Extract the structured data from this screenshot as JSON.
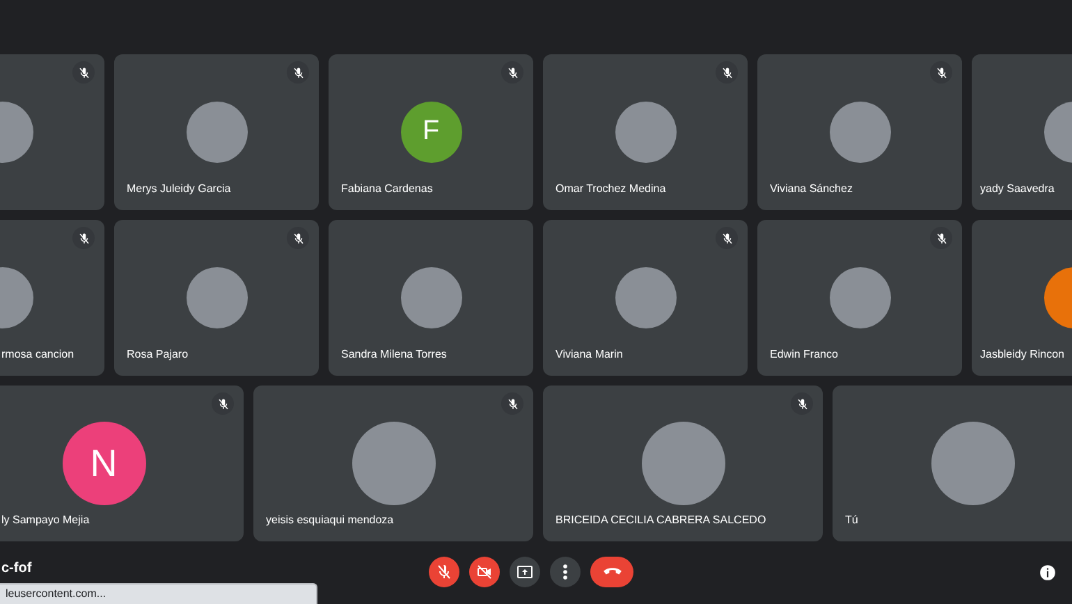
{
  "rows": [
    {
      "tiles": [
        {
          "avatar": {
            "kind": "photo"
          },
          "muted": true
        },
        {
          "name": "Merys Juleidy Garcia",
          "avatar": {
            "kind": "photo"
          },
          "muted": true
        },
        {
          "name": "Fabiana Cardenas",
          "avatar": {
            "kind": "letter",
            "letter": "F",
            "color": "#5e9e2e"
          },
          "muted": true
        },
        {
          "name": "Omar Trochez Medina",
          "avatar": {
            "kind": "photo"
          },
          "muted": true
        },
        {
          "name": "Viviana Sánchez",
          "avatar": {
            "kind": "photo"
          },
          "muted": true
        },
        {
          "name": "yady Saavedra",
          "avatar": {
            "kind": "photo"
          },
          "muted": false
        }
      ]
    },
    {
      "tiles": [
        {
          "name": "rmosa cancion",
          "avatar": {
            "kind": "photo"
          },
          "muted": true
        },
        {
          "name": "Rosa Pajaro",
          "avatar": {
            "kind": "photo"
          },
          "muted": true
        },
        {
          "name": "Sandra Milena Torres",
          "avatar": {
            "kind": "photo"
          },
          "muted": false
        },
        {
          "name": "Viviana Marin",
          "avatar": {
            "kind": "photo"
          },
          "muted": true
        },
        {
          "name": "Edwin Franco",
          "avatar": {
            "kind": "photo"
          },
          "muted": true
        },
        {
          "name": "Jasbleidy Rincon",
          "avatar": {
            "kind": "letter",
            "color": "#e8710a"
          },
          "muted": false
        }
      ]
    },
    {
      "tiles": [
        {
          "name": "ly Sampayo Mejia",
          "avatar": {
            "kind": "letter",
            "letter": "N",
            "color": "#ec407a"
          },
          "muted": true
        },
        {
          "name": "yeisis esquiaqui mendoza",
          "avatar": {
            "kind": "photo"
          },
          "muted": true
        },
        {
          "name": "BRICEIDA CECILIA CABRERA SALCEDO",
          "avatar": {
            "kind": "photo"
          },
          "muted": true
        },
        {
          "name": "Tú",
          "avatar": {
            "kind": "photo"
          },
          "muted": false
        }
      ]
    }
  ],
  "meeting_code": "c-fof",
  "controls": [
    {
      "kind": "mic",
      "on": false
    },
    {
      "kind": "camera",
      "on": false
    },
    {
      "kind": "present"
    },
    {
      "kind": "more"
    },
    {
      "kind": "hangup"
    }
  ],
  "status_url": "leusercontent.com..."
}
